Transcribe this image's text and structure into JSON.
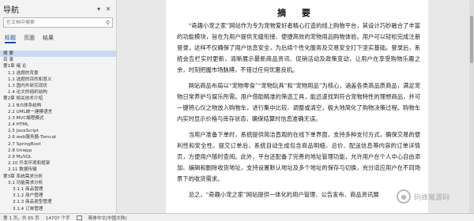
{
  "nav": {
    "title": "导航",
    "search_placeholder": "在文档中搜索",
    "tabs": [
      "标题",
      "页面",
      "结果"
    ],
    "items": [
      {
        "label": "摘 要",
        "level": 0,
        "selected": true
      },
      {
        "label": "目 录",
        "level": 0
      },
      {
        "label": "第1章 绪 论",
        "level": 0
      },
      {
        "label": "1.1 选题的背景",
        "level": 1
      },
      {
        "label": "1.2 选题的目的和意义",
        "level": 1
      },
      {
        "label": "1.3 国内外研究现状",
        "level": 1
      },
      {
        "label": "1.4 论文的组织结构",
        "level": 1
      },
      {
        "label": "第2章 相关技术介绍",
        "level": 0
      },
      {
        "label": "2.1 B/S体系结构",
        "level": 1
      },
      {
        "label": "2.2 UML统一建模语言",
        "level": 1
      },
      {
        "label": "2.3 MVC编程模式",
        "level": 1
      },
      {
        "label": "2.4 HTML",
        "level": 1
      },
      {
        "label": "2.5 JavaScript",
        "level": 1
      },
      {
        "label": "2.6 web服务器-Tomcat",
        "level": 1
      },
      {
        "label": "2.7 SpringBoot",
        "level": 1
      },
      {
        "label": "2.8 Uniapp",
        "level": 1
      },
      {
        "label": "2.9 MySQL",
        "level": 1
      },
      {
        "label": "2.10 开发环境和框架",
        "level": 1
      },
      {
        "label": "2.11 数据传输",
        "level": 1
      },
      {
        "label": "第3章 系统需求分析",
        "level": 0
      },
      {
        "label": "3.1 功能需求分析",
        "level": 1
      },
      {
        "label": "3.1.1 商品管理",
        "level": 2
      },
      {
        "label": "3.1.2 用户管理",
        "level": 2
      },
      {
        "label": "3.1.3 商品类型管理",
        "level": 2
      },
      {
        "label": "3.1.4 订单管理",
        "level": 2
      }
    ]
  },
  "document": {
    "title": "摘 要",
    "paragraphs": [
      "“奇趣小宠之家”网站作为专为宠物爱好者精心打造的线上购物平台，其设计巧妙融合了丰富的功能模块，旨在为用户提供无缝衔接、便捷高效的宠物用品购物体验。用户可以轻松完成注册登录，这样不仅确保了用户信息安全，为后续个性化服务及交易安全打下坚实基础。登录后，系统会告栏实时更新，清晰展示最新商品资讯、促销活动及政策变动，让用户在享受购物乐趣之余，时刻把握市场脉搏，不错过任何优惠良机。",
      "网站商品布局以“宠物零食”“宠物玩具”和“宠物用品”为核心，涵盖各类高品质商品，满足宠物日常养护与娱乐所需。用户借助精准的筛选工具，能迅速找到符合宠物特性的理想商品，并可一键将心仪之物放入购物车，进行集中比较、调整或清空，极大地简化了购物决策过程。购物车内实时显示价格与库存状态，确保结算时信息准确无误。",
      "当用户准备下单时，系统提供简洁直观的在线下单界面，支持多种支付方式，确保交易的便利性和安全性。提交订单后，系统自动生成包含商品明细、总价、配送信息等内容的订单详情页，方便用户随时查阅。此外，平台还配备了完善的地址管理功能，允许用户在个人中心自由添加、编辑和删除收货地址，支持设置默认地址及多个地址的保存与切换，充分适应用户在不同场景下的收货需求。",
      "总之，“奇趣小宠之家”网站提供一体化的用户管理、公告发布、商品资讯展"
    ]
  },
  "status_bar": {
    "page": "第 1 页，共 65 页",
    "words": "14707 个字",
    "language": "简体中文(中国大陆)"
  },
  "watermark": {
    "text": "码蜂窝源码"
  }
}
